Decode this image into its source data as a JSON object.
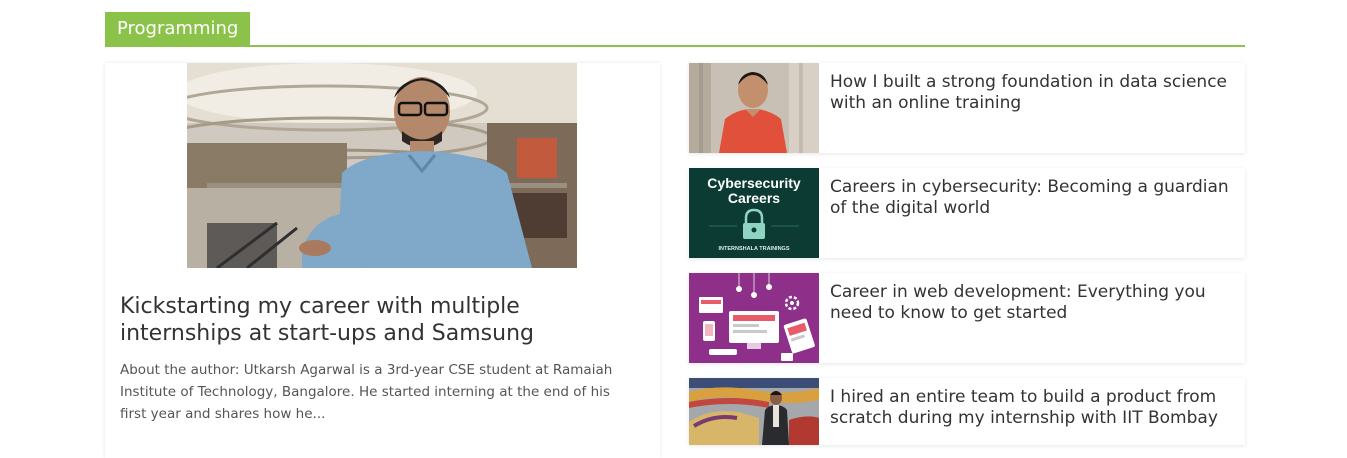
{
  "section": {
    "title": "Programming",
    "accent_color": "#8bc34a"
  },
  "featured": {
    "title": "Kickstarting my career with multiple internships at start-ups and Samsung",
    "excerpt": "About the author: Utkarsh Agarwal is a 3rd-year CSE student at Ramaiah Institute of Technology, Bangalore. He started interning at the end of his first year and shares how he..."
  },
  "posts": [
    {
      "title": "How I built a strong foundation in data science with an online training"
    },
    {
      "title": "Careers in cybersecurity: Becoming a guardian of the digital world",
      "thumb": {
        "line1": "Cybersecurity",
        "line2": "Careers",
        "brand": "INTERNSHALA TRAININGS"
      }
    },
    {
      "title": "Career in web development: Everything you need to know to get started"
    },
    {
      "title": "I hired an entire team to build a product from scratch during my internship with IIT Bombay"
    }
  ]
}
